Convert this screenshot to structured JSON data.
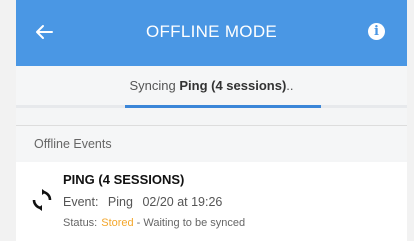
{
  "header": {
    "title": "OFFLINE MODE",
    "back_icon": "arrow-left-icon",
    "info_icon": "info-icon",
    "info_glyph": "i",
    "bar_color": "#4a97e4"
  },
  "sync": {
    "prefix": "Syncing ",
    "item": "Ping (4 sessions)",
    "suffix": "..",
    "progress": 0.5,
    "progress_color": "#3b86d8"
  },
  "section": {
    "title": "Offline Events"
  },
  "event": {
    "name": "PING (4 SESSIONS)",
    "icon": "sync-icon",
    "event_label": "Event:",
    "event_value": "Ping",
    "timestamp": "02/20 at 19:26",
    "status_label": "Status:",
    "status_value": "Stored",
    "status_desc": "- Waiting to be synced",
    "status_color": "#f3a62b"
  }
}
